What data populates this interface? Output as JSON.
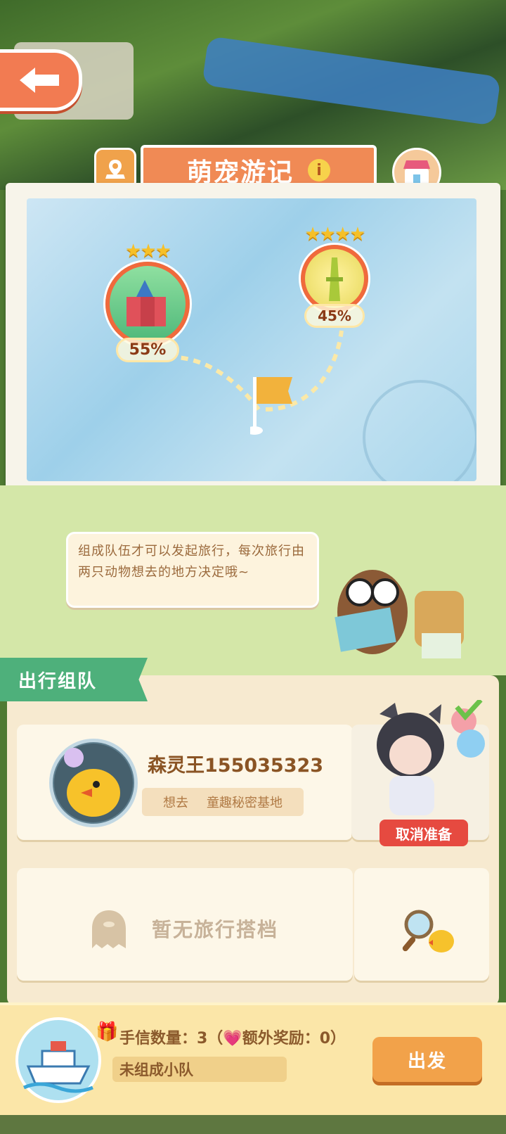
{
  "header": {
    "title": "萌宠游记",
    "info_icon": "i"
  },
  "map": {
    "destinations": [
      {
        "name": "castle",
        "stars": 3,
        "percent": "55%"
      },
      {
        "name": "tower",
        "stars": 4,
        "percent": "45%"
      }
    ]
  },
  "guide": {
    "bubble_text": "组成队伍才可以发起旅行，每次旅行由两只动物想去的地方决定哦~"
  },
  "team": {
    "tab_label": "出行组队",
    "player": {
      "name": "森灵王155035323",
      "want_label": "想去",
      "want_place": "童趣秘密基地"
    },
    "cancel_label": "取消准备",
    "empty_partner_text": "暂无旅行搭档"
  },
  "footer": {
    "letter_count_label": "手信数量：3（",
    "extra_reward_label": "额外奖励：0）",
    "status": "未组成小队",
    "depart_label": "出发"
  },
  "colors": {
    "accent": "#f08a55",
    "team_green": "#4eb07b",
    "cancel_red": "#e64a40",
    "depart_orange": "#f2a24a"
  }
}
